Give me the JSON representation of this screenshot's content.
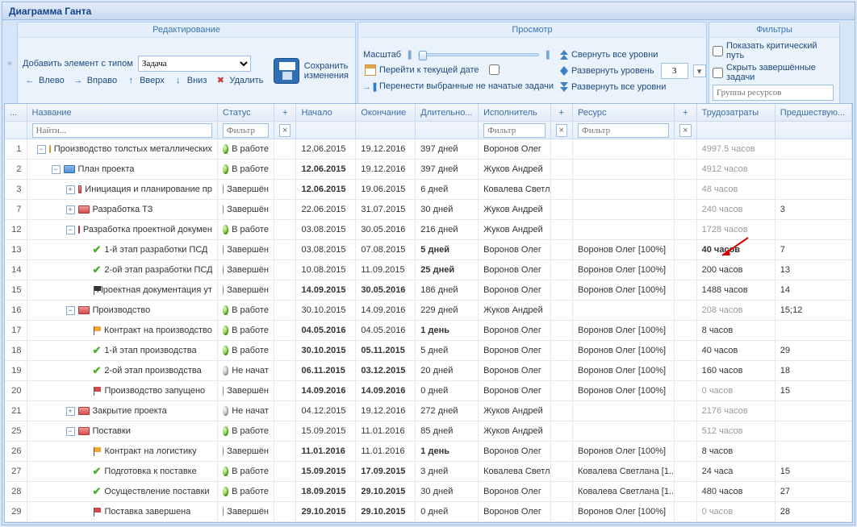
{
  "window": {
    "title": "Диаграмма Ганта"
  },
  "toolbar": {
    "edit": {
      "title": "Редактирование",
      "add_label": "Добавить элемент с типом",
      "type_selected": "Задача",
      "save_l1": "Сохранить",
      "save_l2": "изменения",
      "left": "Влево",
      "right": "Вправо",
      "up": "Вверх",
      "down": "Вниз",
      "delete": "Удалить"
    },
    "view": {
      "title": "Просмотр",
      "scale": "Масштаб",
      "goto_today": "Перейти к текущей дате",
      "move_unstarted": "Перенести выбранные не начатые задачи",
      "collapse_all": "Свернуть все уровни",
      "expand_level": "Развернуть уровень",
      "expand_level_value": "3",
      "expand_all": "Развернуть все уровни"
    },
    "filter": {
      "title": "Фильтры",
      "critical_path": "Показать критический путь",
      "hide_done": "Скрыть завершённые задачи",
      "resource_groups_placeholder": "Группы ресурсов"
    }
  },
  "grid": {
    "headers": {
      "name": "Название",
      "status": "Статус",
      "start": "Начало",
      "end": "Окончание",
      "duration": "Длительно...",
      "executor": "Исполнитель",
      "resource": "Ресурс",
      "labor": "Трудозатраты",
      "pred": "Предшествую..."
    },
    "filters": {
      "name": "Найти...",
      "status": "Фильтр",
      "exec": "Фильтр",
      "res": "Фильтр"
    },
    "rows": [
      {
        "n": "1",
        "depth": 0,
        "toggle": "-",
        "icon": "folder-yellow",
        "name": "Производство толстых металлических",
        "status": "work",
        "start": "12.06.2015",
        "end": "19.12.2016",
        "dur": "397 дней",
        "exec": "Воронов Олег",
        "res": "",
        "lab": "4997.5 часов",
        "lab_gray": true,
        "pred": ""
      },
      {
        "n": "2",
        "depth": 1,
        "toggle": "-",
        "icon": "folder-blue",
        "name": "План проекта",
        "status": "work",
        "start": "12.06.2015",
        "start_b": true,
        "end": "19.12.2016",
        "dur": "397 дней",
        "exec": "Жуков Андрей",
        "res": "",
        "lab": "4912 часов",
        "lab_gray": true,
        "pred": ""
      },
      {
        "n": "3",
        "depth": 2,
        "toggle": "+",
        "icon": "folder-red",
        "name": "Инициация и планирование пр",
        "status": "done",
        "start": "12.06.2015",
        "start_b": true,
        "end": "19.06.2015",
        "dur": "6 дней",
        "exec": "Ковалева Светлана",
        "res": "",
        "lab": "48 часов",
        "lab_gray": true,
        "pred": ""
      },
      {
        "n": "7",
        "depth": 2,
        "toggle": "+",
        "icon": "folder-red",
        "name": "Разработка ТЗ",
        "status": "done",
        "start": "22.06.2015",
        "end": "31.07.2015",
        "dur": "30 дней",
        "exec": "Жуков Андрей",
        "res": "",
        "lab": "240 часов",
        "lab_gray": true,
        "pred": "3"
      },
      {
        "n": "12",
        "depth": 2,
        "toggle": "-",
        "icon": "folder-red",
        "name": "Разработка проектной докумен",
        "status": "work",
        "start": "03.08.2015",
        "end": "30.05.2016",
        "dur": "216 дней",
        "exec": "Жуков Андрей",
        "res": "",
        "lab": "1728 часов",
        "lab_gray": true,
        "pred": ""
      },
      {
        "n": "13",
        "depth": 3,
        "icon": "tick",
        "name": "1-й этап разработки ПСД",
        "status": "done",
        "start": "03.08.2015",
        "end": "07.08.2015",
        "dur": "5 дней",
        "dur_b": true,
        "exec": "Воронов Олег",
        "res": "Воронов Олег [100%]",
        "lab": "40 часов",
        "lab_b": true,
        "pred": "7"
      },
      {
        "n": "14",
        "depth": 3,
        "icon": "tick",
        "name": "2-ой этап разработки ПСД",
        "status": "done",
        "start": "10.08.2015",
        "end": "11.09.2015",
        "dur": "25 дней",
        "dur_b": true,
        "exec": "Воронов Олег",
        "res": "Воронов Олег [100%]",
        "lab": "200 часов",
        "pred": "13"
      },
      {
        "n": "15",
        "depth": 3,
        "icon": "flag-blk",
        "name": "Проектная документация ут",
        "status": "done",
        "start": "14.09.2015",
        "start_b": true,
        "end": "30.05.2016",
        "end_b": true,
        "dur": "186 дней",
        "exec": "Воронов Олег",
        "res": "Воронов Олег [100%]",
        "lab": "1488 часов",
        "pred": "14"
      },
      {
        "n": "16",
        "depth": 2,
        "toggle": "-",
        "icon": "folder-red",
        "name": "Производство",
        "status": "work",
        "start": "30.10.2015",
        "end": "14.09.2016",
        "dur": "229 дней",
        "exec": "Жуков Андрей",
        "res": "",
        "lab": "208 часов",
        "lab_gray": true,
        "pred": "15;12"
      },
      {
        "n": "17",
        "depth": 3,
        "icon": "flag-orn",
        "name": "Контракт на производство",
        "status": "work",
        "start": "04.05.2016",
        "start_b": true,
        "end": "04.05.2016",
        "dur": "1 день",
        "dur_b": true,
        "exec": "Воронов Олег",
        "res": "Воронов Олег [100%]",
        "lab": "8 часов",
        "pred": ""
      },
      {
        "n": "18",
        "depth": 3,
        "icon": "tick",
        "name": "1-й этап производства",
        "status": "work",
        "start": "30.10.2015",
        "start_b": true,
        "end": "05.11.2015",
        "end_b": true,
        "dur": "5 дней",
        "exec": "Воронов Олег",
        "res": "Воронов Олег [100%]",
        "lab": "40 часов",
        "pred": "29"
      },
      {
        "n": "19",
        "depth": 3,
        "icon": "tick",
        "name": "2-ой этап производства",
        "status": "not",
        "start": "06.11.2015",
        "start_b": true,
        "end": "03.12.2015",
        "end_b": true,
        "dur": "20 дней",
        "exec": "Воронов Олег",
        "res": "Воронов Олег [100%]",
        "lab": "160 часов",
        "pred": "18"
      },
      {
        "n": "20",
        "depth": 3,
        "icon": "flag-rd",
        "name": "Производство запущено",
        "status": "done",
        "start": "14.09.2016",
        "start_b": true,
        "end": "14.09.2016",
        "end_b": true,
        "dur": "0 дней",
        "exec": "Воронов Олег",
        "res": "Воронов Олег [100%]",
        "lab": "0 часов",
        "lab_gray": true,
        "pred": "15"
      },
      {
        "n": "21",
        "depth": 2,
        "toggle": "+",
        "icon": "folder-red",
        "name": "Закрытие проекта",
        "status": "not",
        "start": "04.12.2015",
        "end": "19.12.2016",
        "dur": "272 дней",
        "exec": "Жуков Андрей",
        "res": "",
        "lab": "2176 часов",
        "lab_gray": true,
        "pred": ""
      },
      {
        "n": "25",
        "depth": 2,
        "toggle": "-",
        "icon": "folder-red",
        "name": "Поставки",
        "status": "work",
        "start": "15.09.2015",
        "end": "11.01.2016",
        "dur": "85 дней",
        "exec": "Жуков Андрей",
        "res": "",
        "lab": "512 часов",
        "lab_gray": true,
        "pred": ""
      },
      {
        "n": "26",
        "depth": 3,
        "icon": "flag-orn",
        "name": "Контракт на логистику",
        "status": "done",
        "start": "11.01.2016",
        "start_b": true,
        "end": "11.01.2016",
        "dur": "1 день",
        "dur_b": true,
        "exec": "Воронов Олег",
        "res": "Воронов Олег [100%]",
        "lab": "8 часов",
        "pred": ""
      },
      {
        "n": "27",
        "depth": 3,
        "icon": "tick",
        "name": "Подготовка к поставке",
        "status": "work",
        "start": "15.09.2015",
        "start_b": true,
        "end": "17.09.2015",
        "end_b": true,
        "dur": "3 дней",
        "exec": "Ковалева Светлана",
        "res": "Ковалева Светлана [1...",
        "lab": "24 часа",
        "pred": "15"
      },
      {
        "n": "28",
        "depth": 3,
        "icon": "tick",
        "name": "Осуществление поставки",
        "status": "work",
        "start": "18.09.2015",
        "start_b": true,
        "end": "29.10.2015",
        "end_b": true,
        "dur": "30 дней",
        "exec": "Воронов Олег",
        "res": "Ковалева Светлана [1...",
        "lab": "480 часов",
        "pred": "27"
      },
      {
        "n": "29",
        "depth": 3,
        "icon": "flag-rd",
        "name": "Поставка завершена",
        "status": "done",
        "start": "29.10.2015",
        "start_b": true,
        "end": "29.10.2015",
        "end_b": true,
        "dur": "0 дней",
        "exec": "Воронов Олег",
        "res": "Воронов Олег [100%]",
        "lab": "0 часов",
        "lab_gray": true,
        "pred": "28"
      }
    ],
    "status_labels": {
      "work": "В работе",
      "done": "Завершён",
      "not": "Не начат"
    }
  }
}
